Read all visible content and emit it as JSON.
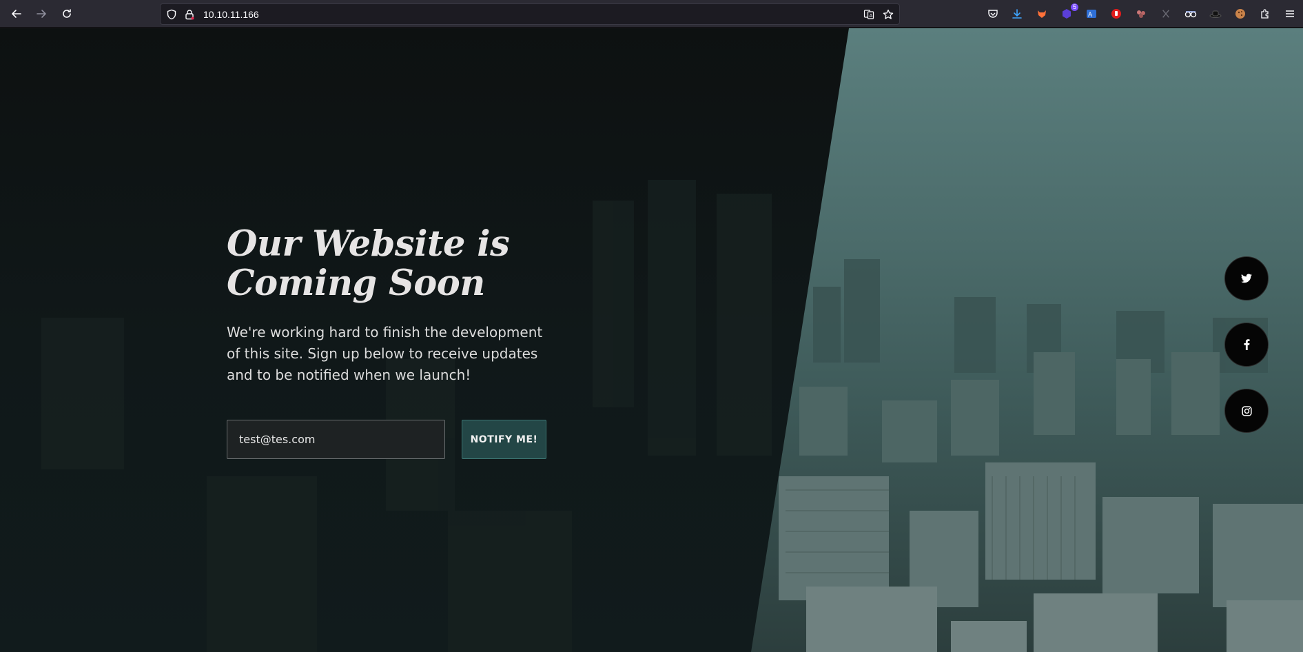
{
  "browser": {
    "url": "10.10.11.166",
    "extension_badge": "5",
    "icons": [
      "back-icon",
      "forward-icon",
      "reload-icon",
      "shield-icon",
      "lock-icon",
      "translate-icon",
      "star-icon",
      "pocket-icon",
      "download-icon",
      "fox-extension-icon",
      "cube-extension-icon",
      "translate-extension-icon",
      "stop-extension-icon",
      "paw-extension-icon",
      "x-extension-icon",
      "spy-extension-icon",
      "hat-extension-icon",
      "cookie-extension-icon",
      "puzzle-icon",
      "menu-icon"
    ]
  },
  "hero": {
    "title_line1": "Our Website is",
    "title_line2": "Coming Soon",
    "description": "We're working hard to finish the development of this site. Sign up below to receive updates and to be notified when we launch!"
  },
  "signup": {
    "email_value": "test@tes.com",
    "button_label": "NOTIFY ME!"
  },
  "social": [
    "twitter-icon",
    "facebook-icon",
    "instagram-icon"
  ],
  "colors": {
    "accent_button": "#234646",
    "dark_panel": "#0b1112",
    "city_tint": "#4a6a68"
  }
}
